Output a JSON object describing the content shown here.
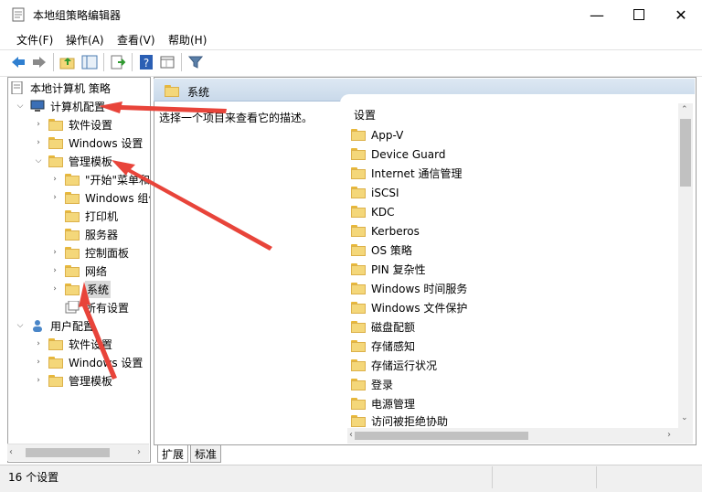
{
  "window": {
    "title": "本地组策略编辑器"
  },
  "menu": [
    "文件(F)",
    "操作(A)",
    "查看(V)",
    "帮助(H)"
  ],
  "tree": {
    "root": "本地计算机 策略",
    "computer": "计算机配置",
    "software": "软件设置",
    "windows": "Windows 设置",
    "admin": "管理模板",
    "start": "\"开始\"菜单和",
    "win_comp": "Windows 组件",
    "printer": "打印机",
    "server": "服务器",
    "control": "控制面板",
    "network": "网络",
    "system": "系统",
    "all": "所有设置",
    "user": "用户配置",
    "u_software": "软件设置",
    "u_windows": "Windows 设置",
    "u_admin": "管理模板"
  },
  "right": {
    "header": "系统",
    "description": "选择一个项目来查看它的描述。",
    "column": "设置",
    "items": [
      "App-V",
      "Device Guard",
      "Internet 通信管理",
      "iSCSI",
      "KDC",
      "Kerberos",
      "OS 策略",
      "PIN 复杂性",
      "Windows 时间服务",
      "Windows 文件保护",
      "磁盘配额",
      "存储感知",
      "存储运行状况",
      "登录",
      "电源管理",
      "访问被拒绝协助"
    ]
  },
  "tabs": [
    "扩展",
    "标准"
  ],
  "status": "16 个设置",
  "colors": {
    "arrow": "#e8443a",
    "folder": "#f4d77a",
    "header": "#c9d9ea"
  }
}
